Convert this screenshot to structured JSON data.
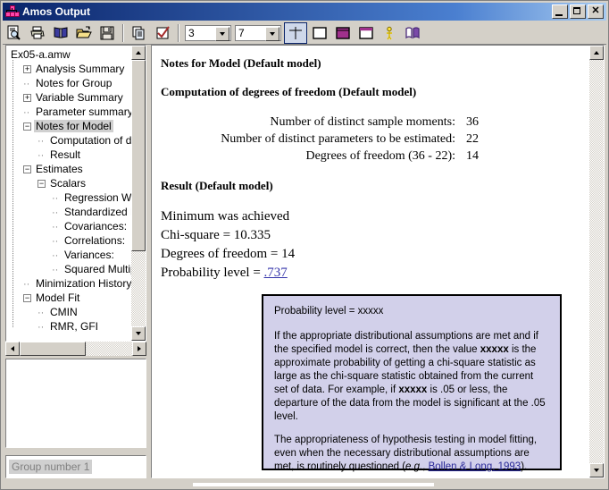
{
  "window": {
    "title": "Amos Output",
    "icon": "amos-path-diagram-icon",
    "buttons": {
      "minimize": "_",
      "maximize": "□",
      "close": "✕"
    }
  },
  "toolbar": {
    "items": [
      {
        "name": "print-preview-icon",
        "label": "Print Preview"
      },
      {
        "name": "print-icon",
        "label": "Print"
      },
      {
        "name": "book-icon",
        "label": "Contents"
      },
      {
        "name": "open-folder-icon",
        "label": "Open"
      },
      {
        "name": "save-icon",
        "label": "Save"
      },
      {
        "name": "copy-icon",
        "label": "Copy"
      },
      {
        "name": "check-options-icon",
        "label": "Options"
      }
    ],
    "decimals_value": "3",
    "width_value": "7",
    "view_buttons": [
      {
        "name": "table-crosshair-icon",
        "label": "Show/hide table gridlines",
        "selected": true
      },
      {
        "name": "blank-table-icon",
        "label": "No shading"
      },
      {
        "name": "magenta-filled-table-icon",
        "label": "Shade whole table"
      },
      {
        "name": "magenta-header-table-icon",
        "label": "Shade table header"
      },
      {
        "name": "person-icon",
        "label": "Group/Model"
      },
      {
        "name": "open-book-icon",
        "label": "Reference"
      }
    ]
  },
  "tree": {
    "root": "Ex05-a.amw",
    "nodes": [
      {
        "label": "Ex05-a.amw",
        "indent": 0,
        "toggle": "none",
        "selected": false
      },
      {
        "label": "Analysis Summary",
        "indent": 1,
        "toggle": "plus",
        "selected": false
      },
      {
        "label": "Notes for Group",
        "indent": 1,
        "toggle": "leaf",
        "selected": false
      },
      {
        "label": "Variable Summary",
        "indent": 1,
        "toggle": "plus",
        "selected": false
      },
      {
        "label": "Parameter summary",
        "indent": 1,
        "toggle": "leaf",
        "selected": false
      },
      {
        "label": "Notes for Model",
        "indent": 1,
        "toggle": "minus",
        "selected": true
      },
      {
        "label": "Computation of degree",
        "indent": 2,
        "toggle": "leaf",
        "selected": false
      },
      {
        "label": "Result",
        "indent": 2,
        "toggle": "leaf",
        "selected": false
      },
      {
        "label": "Estimates",
        "indent": 1,
        "toggle": "minus",
        "selected": false
      },
      {
        "label": "Scalars",
        "indent": 2,
        "toggle": "minus",
        "selected": false
      },
      {
        "label": "Regression Weight",
        "indent": 3,
        "toggle": "leaf",
        "selected": false
      },
      {
        "label": "Standardized Regr",
        "indent": 3,
        "toggle": "leaf",
        "selected": false
      },
      {
        "label": "Covariances:",
        "indent": 3,
        "toggle": "leaf",
        "selected": false
      },
      {
        "label": "Correlations:",
        "indent": 3,
        "toggle": "leaf",
        "selected": false
      },
      {
        "label": "Variances:",
        "indent": 3,
        "toggle": "leaf",
        "selected": false
      },
      {
        "label": "Squared Multiple C",
        "indent": 3,
        "toggle": "leaf",
        "selected": false
      },
      {
        "label": "Minimization History",
        "indent": 1,
        "toggle": "leaf",
        "selected": false
      },
      {
        "label": "Model Fit",
        "indent": 1,
        "toggle": "minus",
        "selected": false
      },
      {
        "label": "CMIN",
        "indent": 2,
        "toggle": "leaf",
        "selected": false
      },
      {
        "label": "RMR, GFI",
        "indent": 2,
        "toggle": "leaf",
        "selected": false
      }
    ]
  },
  "group_panel": {
    "selected_group": "Group number 1"
  },
  "document": {
    "heading1": "Notes for Model (Default model)",
    "heading2": "Computation of degrees of freedom (Default model)",
    "dof_rows": [
      {
        "label": "Number of distinct sample moments:",
        "value": "36"
      },
      {
        "label": "Number of distinct parameters to be estimated:",
        "value": "22"
      },
      {
        "label": "Degrees of freedom (36 - 22):",
        "value": "14"
      }
    ],
    "heading3": "Result (Default model)",
    "result_lines": [
      "Minimum was achieved",
      "Chi-square = 10.335",
      "Degrees of freedom = 14"
    ],
    "prob_label": "Probability level = ",
    "prob_value": ".737"
  },
  "tooltip": {
    "title": "Probability level = xxxxx",
    "para1_a": "If the appropriate distributional assumptions are met and if the specified model is correct, then the value ",
    "para1_b": "xxxxx",
    "para1_c": " is the approximate probability of getting a chi-square statistic as large as the chi-square statistic obtained from the current set of data. For example, if ",
    "para1_d": "xxxxx",
    "para1_e": " is .05 or less, the departure of the data from the model is significant at the .05 level.",
    "para2_a": "The appropriateness of hypothesis testing in model fitting, even when the necessary distributional assumptions are met, is routinely questioned (",
    "para2_em": "e.g.",
    "para2_b": ", ",
    "para2_link": "Bollen & Long, 1993",
    "para2_c": ")."
  },
  "colors": {
    "titlebar_start": "#0a246a",
    "titlebar_end": "#a6caf0",
    "face": "#d4d0c8",
    "tooltip_bg": "#d2d0ea",
    "link": "#3333aa",
    "magenta": "#a0308c"
  }
}
